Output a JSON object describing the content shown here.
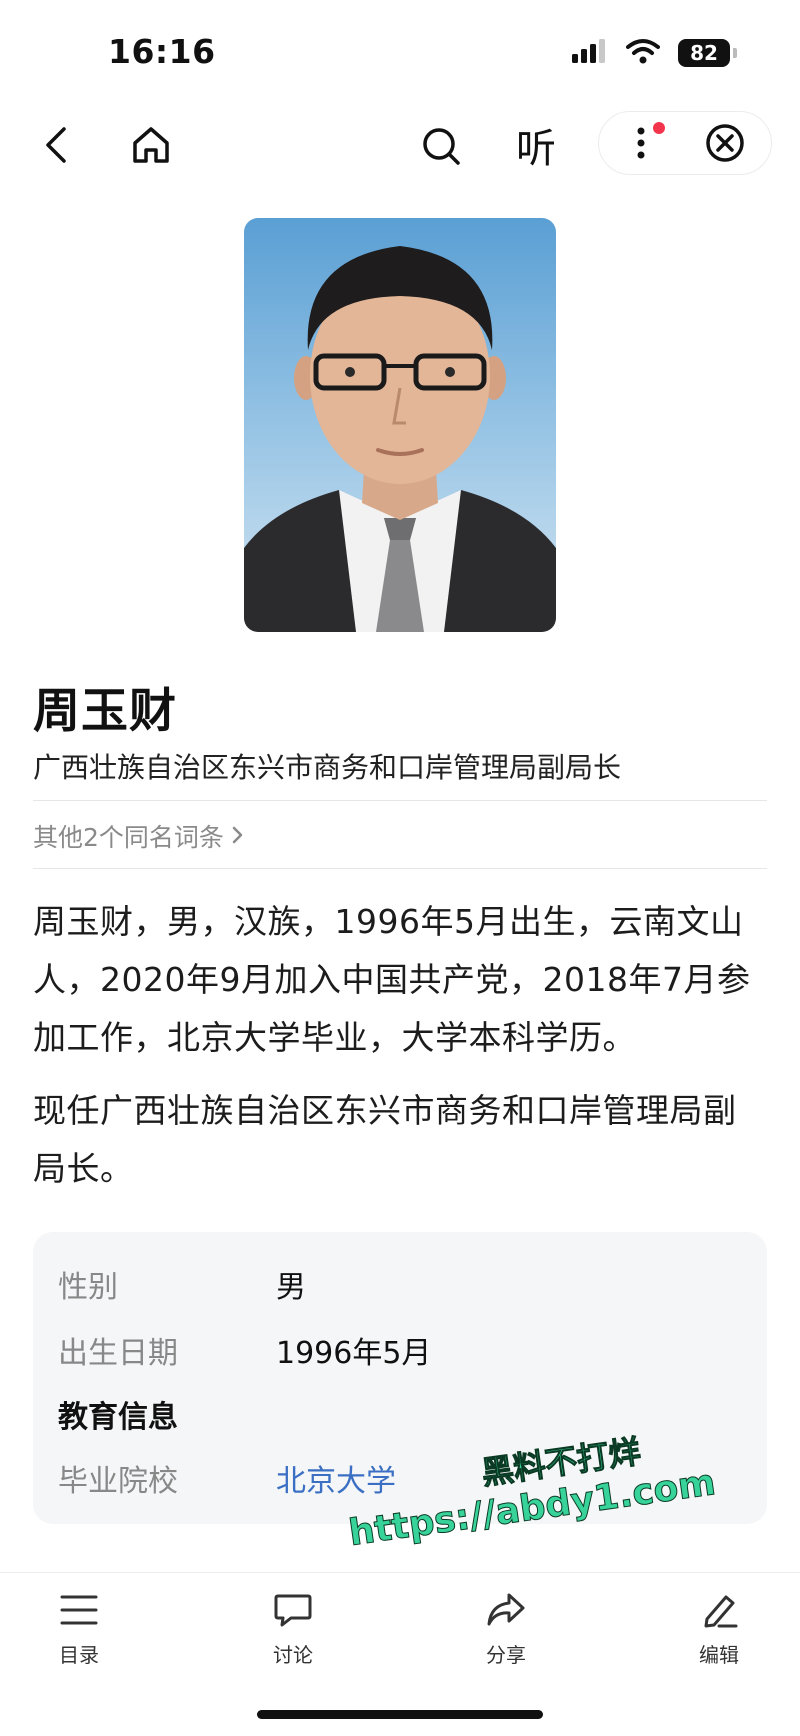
{
  "status_bar": {
    "time": "16:16",
    "battery": "82",
    "icons": [
      "cellular-signal-icon",
      "wifi-icon",
      "battery-icon"
    ]
  },
  "nav": {
    "listen_label": "听",
    "icons": [
      "back-icon",
      "home-icon",
      "search-icon",
      "more-icon",
      "close-icon"
    ],
    "notification_dot_color": "#f2354d"
  },
  "entry": {
    "name": "周玉财",
    "subtitle": "广西壮族自治区东兴市商务和口岸管理局副局长",
    "other_entries": "其他2个同名词条",
    "paragraphs": [
      "周玉财，男，汉族，1996年5月出生，云南文山人，2020年9月加入中国共产党，2018年7月参加工作，北京大学毕业，大学本科学历。",
      "现任广西壮族自治区东兴市商务和口岸管理局副局长。"
    ]
  },
  "info_card": {
    "rows": [
      {
        "key": "性别",
        "value": "男"
      },
      {
        "key": "出生日期",
        "value": "1996年5月"
      }
    ],
    "section_title": "教育信息",
    "education": {
      "key": "毕业院校",
      "value": "北京大学"
    },
    "link_color": "#3a6fc4"
  },
  "watermark": {
    "line1": "黑料不打烊",
    "line2": "https://abdy1.com"
  },
  "tab_bar": {
    "items": [
      {
        "label": "目录",
        "icon": "list-icon"
      },
      {
        "label": "讨论",
        "icon": "comment-icon"
      },
      {
        "label": "分享",
        "icon": "share-icon"
      },
      {
        "label": "编辑",
        "icon": "edit-icon"
      }
    ]
  }
}
